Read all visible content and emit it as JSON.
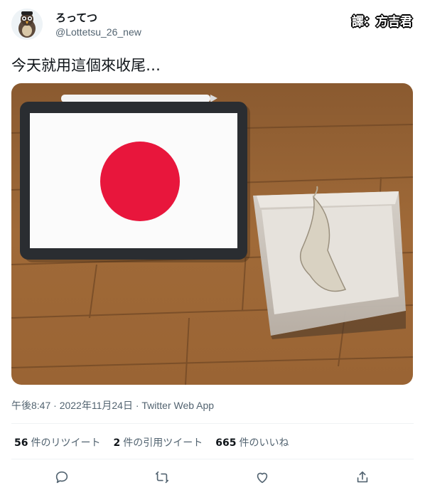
{
  "author": {
    "display_name": "ろってつ",
    "handle": "@Lottetsu_26_new"
  },
  "translator_badge": "譯：方吉君",
  "tweet": {
    "text": "今天就用這個來收尾…",
    "timestamp": "午後8:47 · 2022年11月24日 · Twitter Web App"
  },
  "stats": [
    {
      "count": "56",
      "label": "件のリツイート"
    },
    {
      "count": "2",
      "label": "件の引用ツイート"
    },
    {
      "count": "665",
      "label": "件のいいね"
    }
  ],
  "actions": [
    "reply-icon",
    "retweet-icon",
    "like-icon",
    "share-icon"
  ],
  "colors": {
    "flag_red": "#e8163c",
    "link_gray": "#536471",
    "text": "#0f1419",
    "divider": "#eff3f4"
  }
}
